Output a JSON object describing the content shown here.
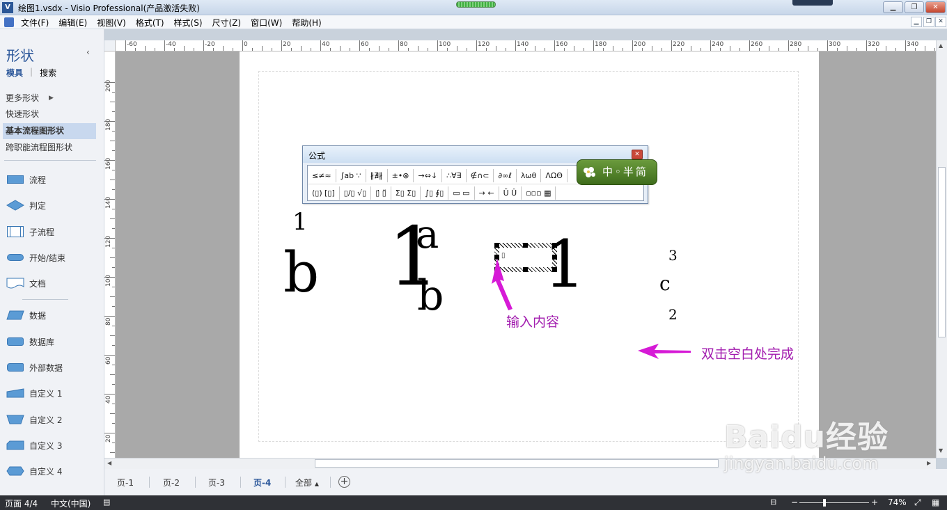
{
  "window": {
    "title": "绘图1.vsdx - Visio Professional(产品激活失败)",
    "app_icon": "V"
  },
  "menu": [
    "文件(F)",
    "编辑(E)",
    "视图(V)",
    "格式(T)",
    "样式(S)",
    "尺寸(Z)",
    "窗口(W)",
    "帮助(H)"
  ],
  "shapes_panel": {
    "title": "形状",
    "tab_stencils": "模具",
    "tab_search": "搜索",
    "more_shapes": "更多形状",
    "stencils": [
      "快速形状",
      "基本流程图形状",
      "跨职能流程图形状"
    ],
    "active_stencil": "基本流程图形状",
    "items": [
      {
        "label": "流程",
        "icon": "process-icon"
      },
      {
        "label": "判定",
        "icon": "decision-icon"
      },
      {
        "label": "子流程",
        "icon": "subprocess-icon"
      },
      {
        "label": "开始/结束",
        "icon": "terminator-icon"
      },
      {
        "label": "文档",
        "icon": "document-icon"
      },
      {
        "label": "数据",
        "icon": "data-icon"
      },
      {
        "label": "数据库",
        "icon": "database-icon"
      },
      {
        "label": "外部数据",
        "icon": "external-data-icon"
      },
      {
        "label": "自定义 1",
        "icon": "custom1-icon"
      },
      {
        "label": "自定义 2",
        "icon": "custom2-icon"
      },
      {
        "label": "自定义 3",
        "icon": "custom3-icon"
      },
      {
        "label": "自定义 4",
        "icon": "custom4-icon"
      }
    ]
  },
  "ruler": {
    "h_labels": [
      "-60",
      "-40",
      "-20",
      "0",
      "20",
      "40",
      "60",
      "80",
      "100",
      "120",
      "140",
      "160",
      "180",
      "200",
      "220",
      "240",
      "260",
      "280",
      "300",
      "320",
      "340"
    ],
    "v_labels": [
      "200",
      "180",
      "160",
      "140",
      "120",
      "100",
      "80",
      "60",
      "40",
      "20"
    ]
  },
  "formula_toolbar": {
    "title": "公式",
    "row1": [
      "≤≠≈",
      "∫ab ∵",
      "∦∄∦",
      "±•⊗",
      "→⇔↓",
      "∴∀∃",
      "∉∩⊂",
      "∂∞ℓ",
      "λωθ",
      "ΛΩΘ"
    ],
    "row2": [
      "(▯) [▯]",
      "▯/▯ √▯",
      "▯̈ ▯̃",
      "Σ▯ Σ▯",
      "∫▯ ∮▯",
      "▭ ▭",
      "→ ←",
      "Ū Û",
      "▫▫▫ ▦"
    ]
  },
  "ime": {
    "text": "中◦半简"
  },
  "equations": {
    "eq1_top": "1",
    "eq1_main": "b",
    "eq2_big": "1",
    "eq2_sup": "a",
    "eq2_sub": "b",
    "eq3_right": "1",
    "eq3_cursor": "▯",
    "eq4_top": "3",
    "eq4_main": "c",
    "eq4_bottom": "2"
  },
  "annotations": {
    "input_hint": "输入内容",
    "finish_hint": "双击空白处完成",
    "color": "#a21caf"
  },
  "page_tabs": [
    "页-1",
    "页-2",
    "页-3",
    "页-4",
    "全部"
  ],
  "active_page": "页-4",
  "status_bar": {
    "page_info": "页面 4/4",
    "language": "中文(中国)",
    "zoom": "74%"
  },
  "watermark": {
    "line1": "Baidu经验",
    "line2": "jingyan.baidu.com"
  }
}
